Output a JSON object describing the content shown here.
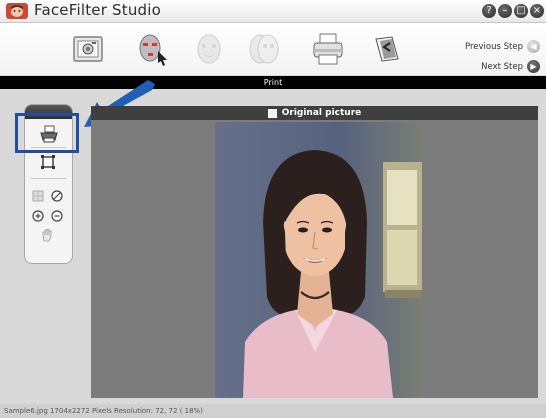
{
  "app": {
    "title": "FaceFilter Studio",
    "logo_icon": "face-logo-icon"
  },
  "window_controls": [
    {
      "name": "help-icon",
      "glyph": "?"
    },
    {
      "name": "minimize-icon",
      "glyph": "–"
    },
    {
      "name": "maximize-icon",
      "glyph": "□"
    },
    {
      "name": "close-icon",
      "glyph": "×"
    }
  ],
  "toolbar": {
    "steps": [
      {
        "name": "open-picture-step",
        "icon": "camera-icon",
        "state": "active"
      },
      {
        "name": "face-detect-step",
        "icon": "face-red-points-icon",
        "state": "active"
      },
      {
        "name": "face-adjust-step",
        "icon": "face-faded-icon",
        "state": "disabled"
      },
      {
        "name": "face-compare-step",
        "icon": "face-faded-icon",
        "state": "disabled"
      },
      {
        "name": "print-step",
        "icon": "printer-icon",
        "state": "current"
      },
      {
        "name": "back-step",
        "icon": "back-arrow-icon",
        "state": "active"
      }
    ],
    "previous_label": "Previous Step",
    "next_label": "Next Step"
  },
  "mode_bar": {
    "label": "Print"
  },
  "tools": [
    {
      "name": "print-tool",
      "icon": "printer-icon",
      "highlighted": true
    },
    {
      "name": "crop-tool",
      "icon": "crop-frame-icon"
    },
    {
      "name": "fit-tool",
      "icon": "fit-grid-icon"
    },
    {
      "name": "rotate-tool",
      "icon": "no-sign-icon"
    },
    {
      "name": "zoom-in-tool",
      "icon": "zoom-in-icon"
    },
    {
      "name": "zoom-out-tool",
      "icon": "zoom-out-icon"
    },
    {
      "name": "pan-tool",
      "icon": "hand-icon"
    }
  ],
  "picture": {
    "header_label": "Original picture",
    "checkbox_checked": false
  },
  "status": {
    "text": "Sample6.jpg    1704x2272 Pixels    Resolution: 72, 72 ( 18%)"
  },
  "colors": {
    "highlight_border": "#1f4e9e",
    "arrow_fill": "#1f5fb8",
    "title_logo": "#c84a3a",
    "mode_bar": "#000000"
  }
}
